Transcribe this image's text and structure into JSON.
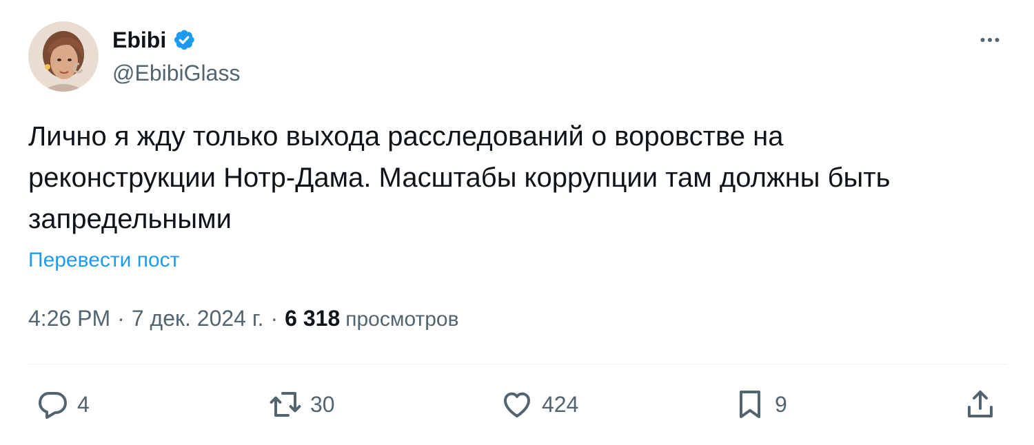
{
  "author": {
    "display_name": "Ebibi",
    "handle": "@EbibiGlass",
    "verified_icon": "verified-badge-icon",
    "verified_color": "#1d9bf0"
  },
  "tweet": {
    "text": "Лично я жду только выхода расследований о воровстве на\nреконструкции Нотр-Дама. Масштабы коррупции там должны быть\nзапредельными",
    "translate_label": "Перевести пост",
    "time": "4:26 PM",
    "separator": "·",
    "date": "7 дек. 2024 г.",
    "views_count": "6 318",
    "views_label": "просмотров"
  },
  "actions": {
    "reply": {
      "icon": "reply-icon",
      "count": "4"
    },
    "retweet": {
      "icon": "retweet-icon",
      "count": "30"
    },
    "like": {
      "icon": "heart-icon",
      "count": "424"
    },
    "bookmark": {
      "icon": "bookmark-icon",
      "count": "9"
    },
    "share": {
      "icon": "share-icon"
    }
  },
  "colors": {
    "text_primary": "#0f1419",
    "text_secondary": "#536471",
    "link": "#1d9bf0",
    "divider": "#eff3f4"
  }
}
